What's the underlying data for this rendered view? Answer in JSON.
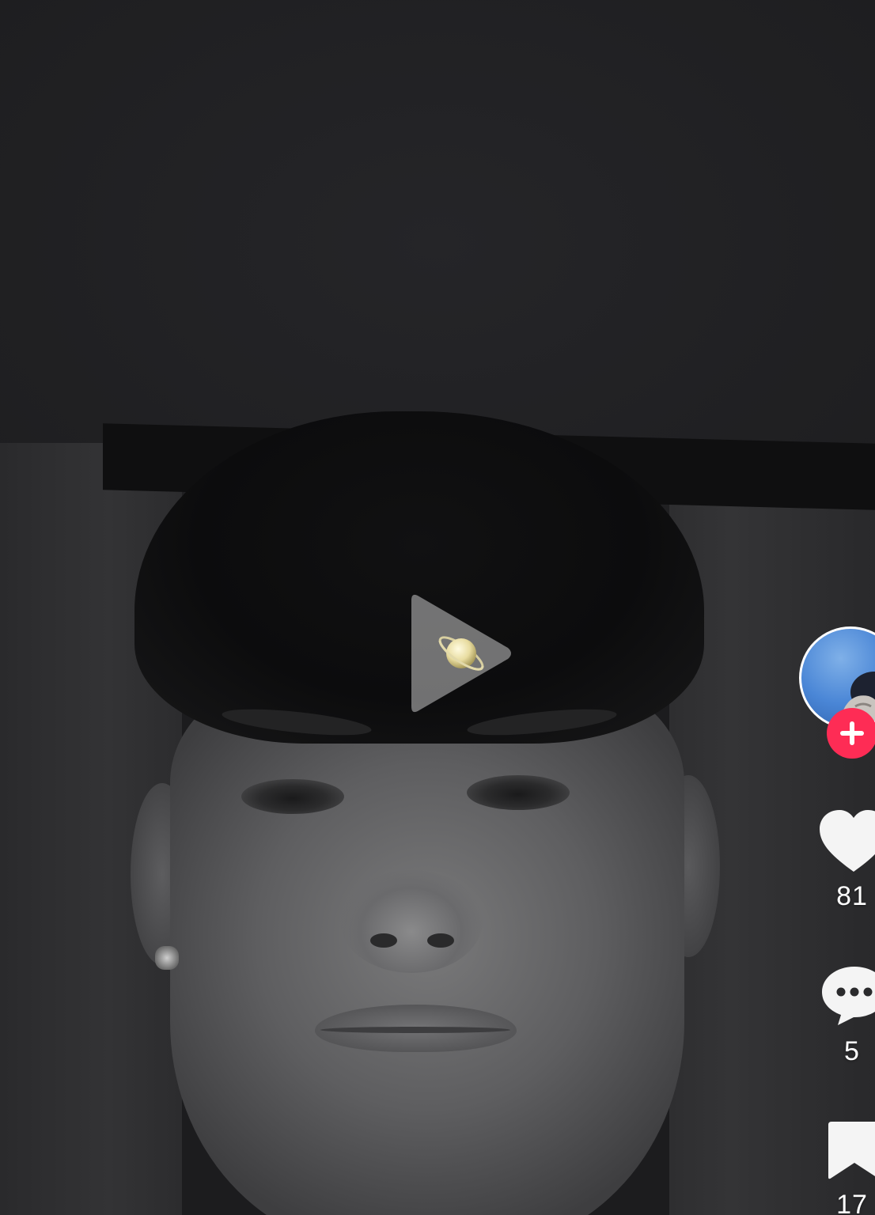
{
  "actions": {
    "likes": "81",
    "comments": "5",
    "bookmarks": "17"
  },
  "icons": {
    "play": "play-icon",
    "planet": "planet-icon",
    "follow": "plus-icon",
    "like": "heart-icon",
    "comment": "speech-bubble-icon",
    "bookmark": "bookmark-icon"
  },
  "colors": {
    "follow_button": "#fe2c55",
    "icon_fill": "#ffffff",
    "avatar_ring": "#ffffff"
  }
}
